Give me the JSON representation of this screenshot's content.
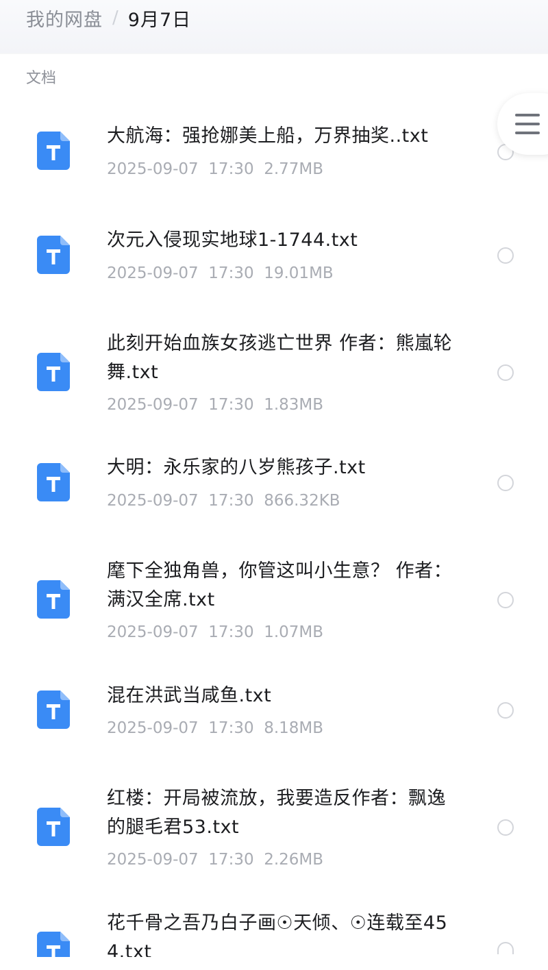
{
  "header": {
    "breadcrumb_root": "我的网盘",
    "breadcrumb_separator": "/",
    "breadcrumb_current": "9月7日"
  },
  "section": {
    "label": "文档"
  },
  "colors": {
    "icon_blue": "#3a8bf5",
    "icon_fold": "#8fbdfa"
  },
  "files": [
    {
      "name": "大航海：强抢娜美上船，万界抽奖..txt",
      "date": "2025-09-07",
      "time": "17:30",
      "size": "2.77MB",
      "icon": "txt-file-icon"
    },
    {
      "name": "次元入侵现实地球1-1744.txt",
      "date": "2025-09-07",
      "time": "17:30",
      "size": "19.01MB",
      "icon": "txt-file-icon"
    },
    {
      "name": "此刻开始血族女孩逃亡世界 作者：熊嵐轮舞.txt",
      "date": "2025-09-07",
      "time": "17:30",
      "size": "1.83MB",
      "icon": "txt-file-icon"
    },
    {
      "name": "大明：永乐家的八岁熊孩子.txt",
      "date": "2025-09-07",
      "time": "17:30",
      "size": "866.32KB",
      "icon": "txt-file-icon"
    },
    {
      "name": "麾下全独角兽，你管这叫小生意？ 作者：满汉全席.txt",
      "date": "2025-09-07",
      "time": "17:30",
      "size": "1.07MB",
      "icon": "txt-file-icon"
    },
    {
      "name": "混在洪武当咸鱼.txt",
      "date": "2025-09-07",
      "time": "17:30",
      "size": "8.18MB",
      "icon": "txt-file-icon"
    },
    {
      "name": "红楼：开局被流放，我要造反作者：飘逸的腿毛君53.txt",
      "date": "2025-09-07",
      "time": "17:30",
      "size": "2.26MB",
      "icon": "txt-file-icon"
    },
    {
      "name": "花千骨之吾乃白子画☉天倾、☉连载至454.txt",
      "date": "",
      "time": "",
      "size": "",
      "icon": "txt-file-icon"
    }
  ]
}
